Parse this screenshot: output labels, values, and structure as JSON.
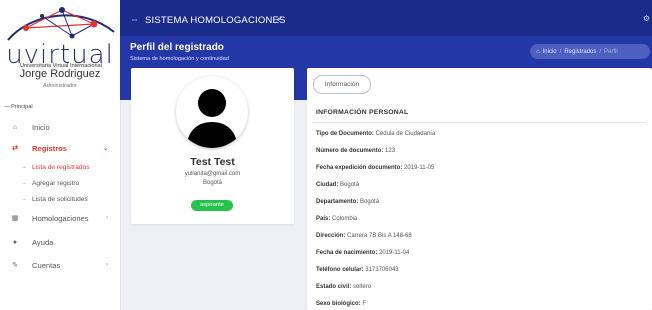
{
  "sidebar": {
    "brand": "uvirtual",
    "brand_subtitle": "Universitaria Virtual Internacional",
    "user_name": "Jorge Rodriguez",
    "user_role": "Administrador",
    "section_label": "— Principal",
    "items": [
      {
        "label": "Inicio",
        "icon": "home-icon"
      },
      {
        "label": "Registros",
        "icon": "registros-icon"
      },
      {
        "label": "Homologaciones",
        "icon": "homologaciones-icon"
      },
      {
        "label": "Ayuda",
        "icon": "help-icon"
      },
      {
        "label": "Cuentas",
        "icon": "accounts-icon"
      }
    ],
    "subitems": [
      {
        "label": "Lista de registrados"
      },
      {
        "label": "Agregar registro"
      },
      {
        "label": "Lista de solicitudes"
      }
    ]
  },
  "topbar": {
    "title": "SISTEMA HOMOLOGACIONES"
  },
  "header": {
    "title": "Perfil del registrado",
    "subtitle": "Sistema de homologación y continuidad",
    "breadcrumb": [
      "Inicio",
      "Registrados",
      "Perfil"
    ]
  },
  "profile": {
    "name": "Test Test",
    "email": "yulianita@gmail.com",
    "city": "Bogotá",
    "status": "aspirante"
  },
  "info": {
    "tab_label": "Información",
    "section_title": "INFORMACIÓN PERSONAL",
    "fields": [
      {
        "label": "Tipo de Documento:",
        "value": "Cédula de Ciudadanía"
      },
      {
        "label": "Número de documento:",
        "value": "123"
      },
      {
        "label": "Fecha expedición documento:",
        "value": "2019-11-05"
      },
      {
        "label": "Ciudad:",
        "value": "Bogotá"
      },
      {
        "label": "Departamento:",
        "value": "Bogotá"
      },
      {
        "label": "País:",
        "value": "Colombia"
      },
      {
        "label": "Dirección:",
        "value": "Carrera 7B Bis A 148-68"
      },
      {
        "label": "Fecha de nacimiento:",
        "value": "2019-11-04"
      },
      {
        "label": "Teléfono celular:",
        "value": "3173706043"
      },
      {
        "label": "Estado civil:",
        "value": "soltero"
      },
      {
        "label": "Sexo biológico:",
        "value": "F"
      }
    ]
  },
  "colors": {
    "primary": "#2437a6",
    "topbar": "#1b2b8c",
    "accent": "#e3342f",
    "success": "#27c24c"
  }
}
